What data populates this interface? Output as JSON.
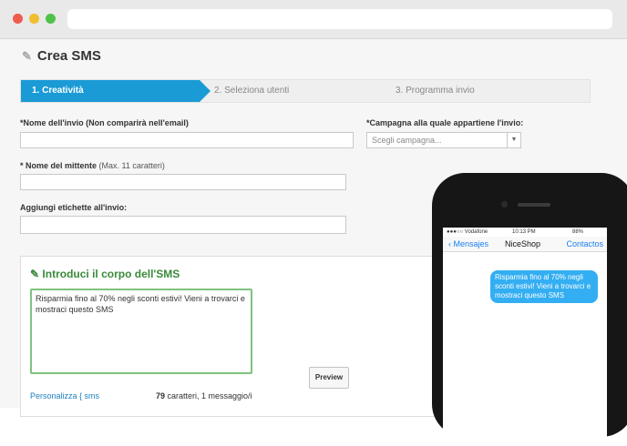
{
  "page": {
    "title": "Crea SMS"
  },
  "steps": [
    {
      "label": "1. Creatività"
    },
    {
      "label": "2. Seleziona utenti"
    },
    {
      "label": "3. Programma invio"
    }
  ],
  "form": {
    "name_label": "*Nome dell'invio (Non comparirà nell'email)",
    "campaign_label": "*Campagna alla quale appartiene l'invio:",
    "campaign_placeholder": "Scegli campagna...",
    "sender_label": "* Nome del mittente",
    "sender_hint": "(Max. 11 caratteri)",
    "tags_label": "Aggiungi etichette all'invio:"
  },
  "sms": {
    "section_title": "Introduci il corpo dell'SMS",
    "message": "Risparmia fino al 70% negli sconti estivi! Vieni a trovarci e mostraci questo SMS",
    "preview_button": "Preview",
    "personalize_link": "Personalizza { sms",
    "count_bold": "79",
    "count_text": " caratteri, 1 messaggio/i"
  },
  "phone": {
    "carrier": "●●●○○ Vodafone",
    "time": "10:13 PM",
    "battery": "88%",
    "back_label": "Mensajes",
    "contact_name": "NiceShop",
    "right_label": "Contactos",
    "bubble_text": "Risparmia fino al 70% negli sconti estivi! Vieni a trovarci e mostraci questo SMS"
  },
  "colors": {
    "accent": "#1b9bd6",
    "green": "#3a8a3a",
    "bubble": "#34aef2"
  }
}
